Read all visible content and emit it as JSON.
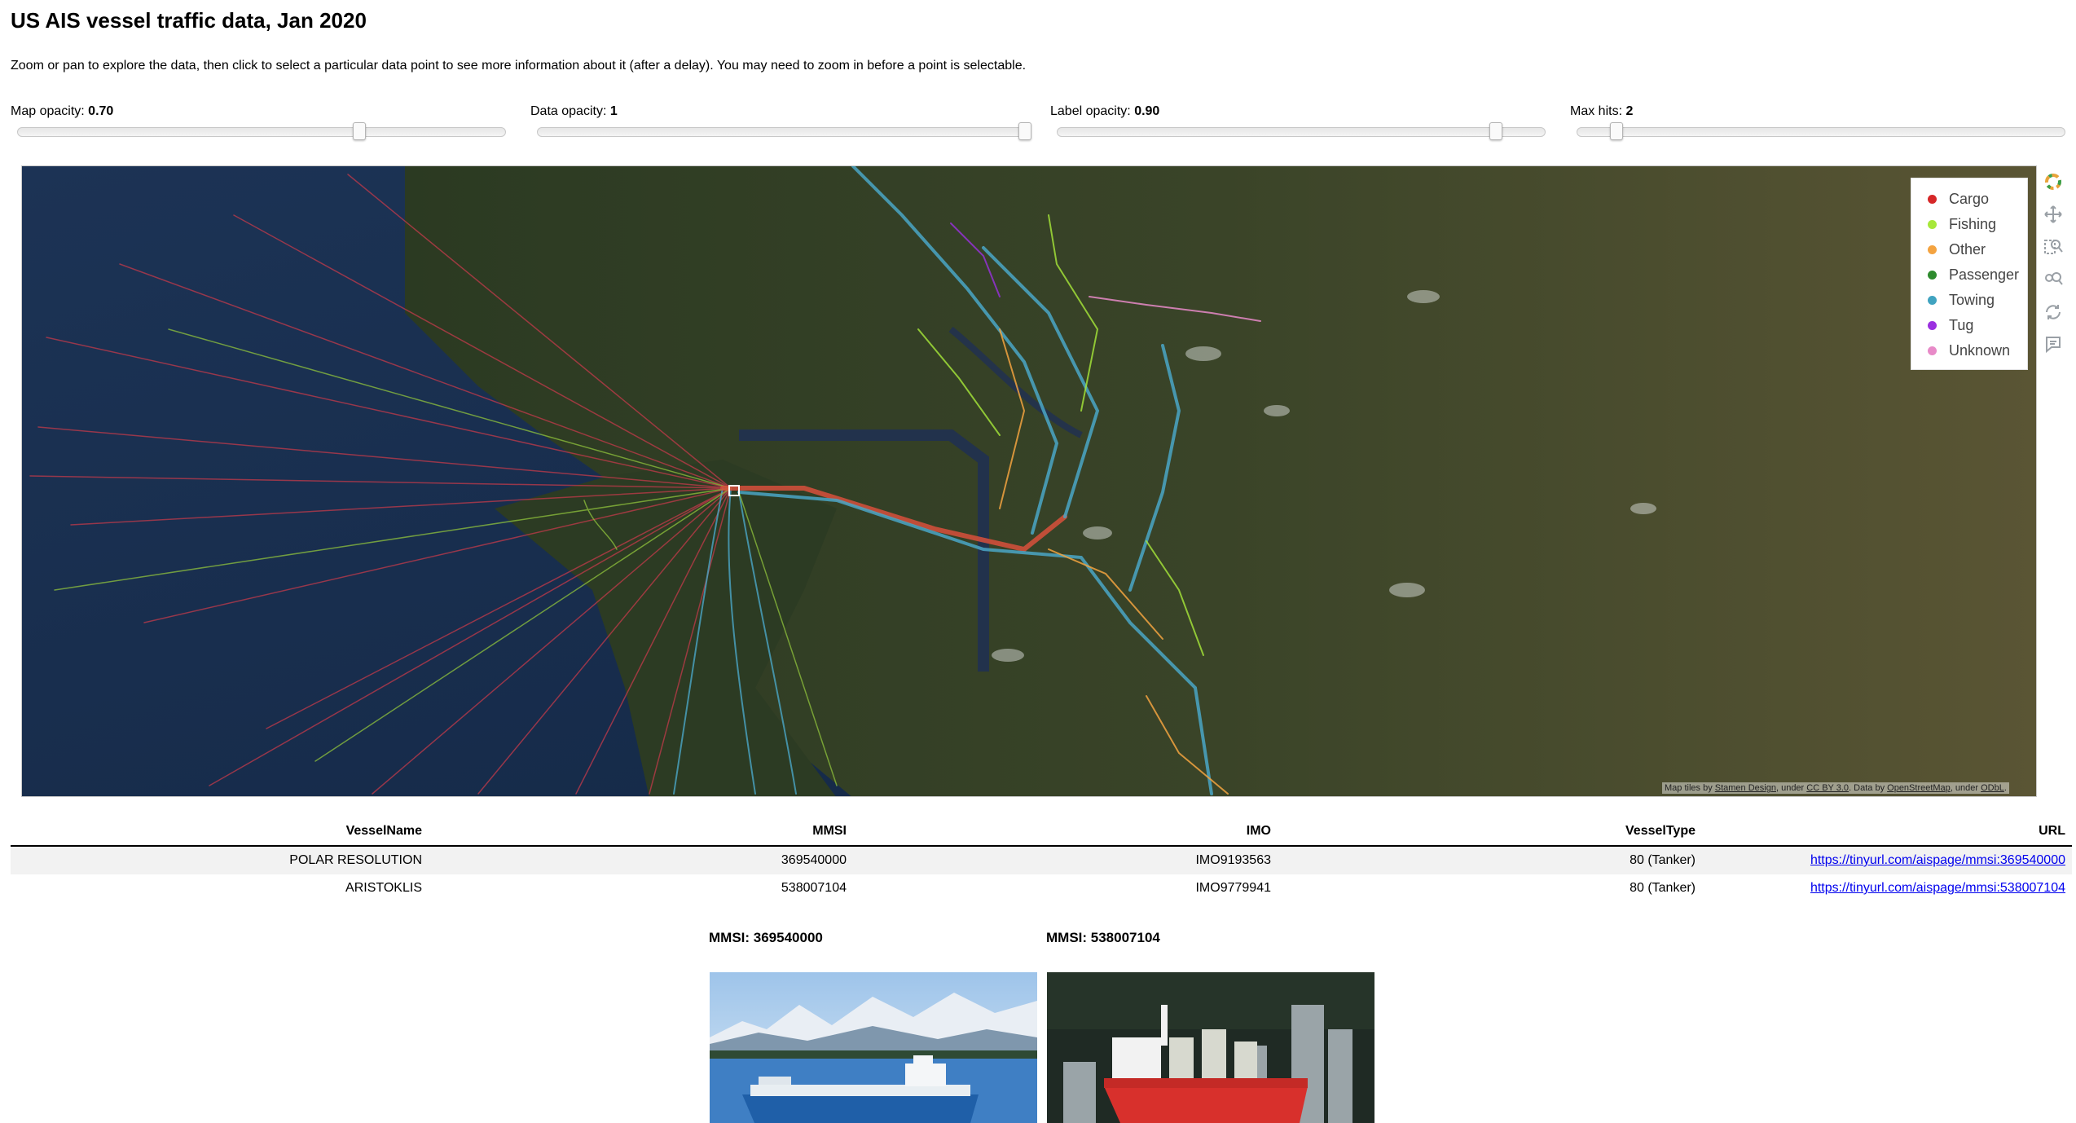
{
  "page": {
    "title": "US AIS vessel traffic data, Jan 2020",
    "intro": "Zoom or pan to explore the data, then click to select a particular data point to see more information about it (after a delay). You may need to zoom in before a point is selectable."
  },
  "sliders": [
    {
      "label": "Map opacity:",
      "value": "0.70",
      "fraction": 0.7
    },
    {
      "label": "Data opacity:",
      "value": "1",
      "fraction": 1.0
    },
    {
      "label": "Label opacity:",
      "value": "0.90",
      "fraction": 0.9
    },
    {
      "label": "Max hits:",
      "value": "2",
      "fraction": 0.08
    }
  ],
  "legend": [
    {
      "label": "Cargo",
      "color": "#d62728"
    },
    {
      "label": "Fishing",
      "color": "#a7e83a"
    },
    {
      "label": "Other",
      "color": "#f4a340"
    },
    {
      "label": "Passenger",
      "color": "#2e8b2e"
    },
    {
      "label": "Towing",
      "color": "#40a3c0"
    },
    {
      "label": "Tug",
      "color": "#9b30e0"
    },
    {
      "label": "Unknown",
      "color": "#e88ac8"
    }
  ],
  "attribution": {
    "prefix": "Map tiles by ",
    "stamen": "Stamen Design",
    "mid": ", under ",
    "cc": "CC BY 3.0",
    "data": ". Data by ",
    "osm": "OpenStreetMap",
    "under": ", under ",
    "odbl": "ODbL",
    "end": "."
  },
  "toolbar": [
    "bokeh-logo-icon",
    "pan-icon",
    "box-zoom-icon",
    "wheel-zoom-icon",
    "reset-icon",
    "hover-icon"
  ],
  "table": {
    "headers": {
      "name": "VesselName",
      "mmsi": "MMSI",
      "imo": "IMO",
      "type": "VesselType",
      "url": "URL"
    },
    "rows": [
      {
        "name": "POLAR RESOLUTION",
        "mmsi": "369540000",
        "imo": "IMO9193563",
        "type": "80 (Tanker)",
        "url": "https://tinyurl.com/aispage/mmsi:369540000"
      },
      {
        "name": "ARISTOKLIS",
        "mmsi": "538007104",
        "imo": "IMO9779941",
        "type": "80 (Tanker)",
        "url": "https://tinyurl.com/aispage/mmsi:538007104"
      }
    ]
  },
  "cards": [
    {
      "label": "MMSI: 369540000"
    },
    {
      "label": "MMSI: 538007104"
    }
  ]
}
